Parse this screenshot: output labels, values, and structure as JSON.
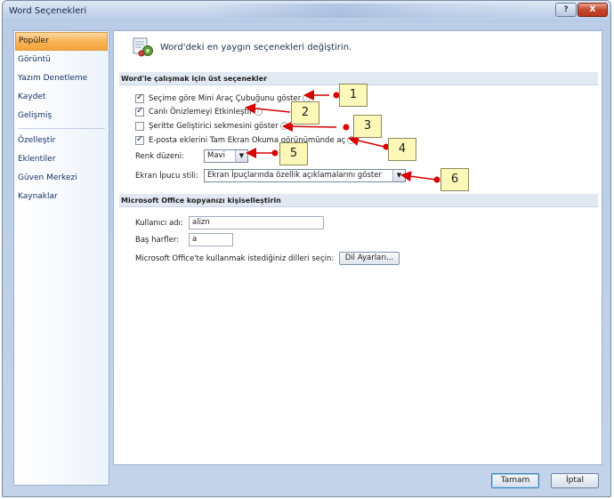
{
  "window": {
    "title": "Word Seçenekleri",
    "help_label": "?",
    "close_label": "X"
  },
  "sidebar": {
    "items": [
      {
        "label": "Popüler",
        "active": true
      },
      {
        "label": "Görüntü"
      },
      {
        "label": "Yazım Denetleme"
      },
      {
        "label": "Kaydet"
      },
      {
        "label": "Gelişmiş"
      },
      {
        "label": "Özelleştir"
      },
      {
        "label": "Eklentiler"
      },
      {
        "label": "Güven Merkezi"
      },
      {
        "label": "Kaynaklar"
      }
    ]
  },
  "main": {
    "header": "Word'deki en yaygın seçenekleri değiştirin.",
    "section1": {
      "title": "Word'le çalışmak için üst seçenekler",
      "options": [
        {
          "label": "Seçime göre Mini Araç Çubuğunu göster",
          "checked": true
        },
        {
          "label": "Canlı Önizlemeyi Etkinleştir",
          "checked": true
        },
        {
          "label": "Şeritte Geliştirici sekmesini göster",
          "checked": false
        },
        {
          "label": "E-posta eklerini Tam Ekran Okuma görünümünde aç",
          "checked": true
        }
      ],
      "color_scheme_label": "Renk düzeni:",
      "color_scheme_value": "Mavi",
      "screentip_label": "Ekran İpucu stili:",
      "screentip_value": "Ekran İpuçlarında özellik açıklamalarını göster"
    },
    "section2": {
      "title": "Microsoft Office kopyanızı kişiselleştirin",
      "username_label": "Kullanıcı adı:",
      "username_value": "alizn",
      "initials_label": "Baş harfler:",
      "initials_value": "a",
      "language_text": "Microsoft Office'te kullanmak istediğiniz dilleri seçin:",
      "language_button": "Dil Ayarları..."
    }
  },
  "footer": {
    "ok_label": "Tamam",
    "cancel_label": "İptal"
  },
  "callouts": [
    "1",
    "2",
    "3",
    "4",
    "5",
    "6"
  ],
  "colors": {
    "accent": "#f6a33a",
    "callout_fill": "#fdf7b8",
    "arrow_red": "#d60000",
    "window_frame": "#b9cbe6"
  }
}
